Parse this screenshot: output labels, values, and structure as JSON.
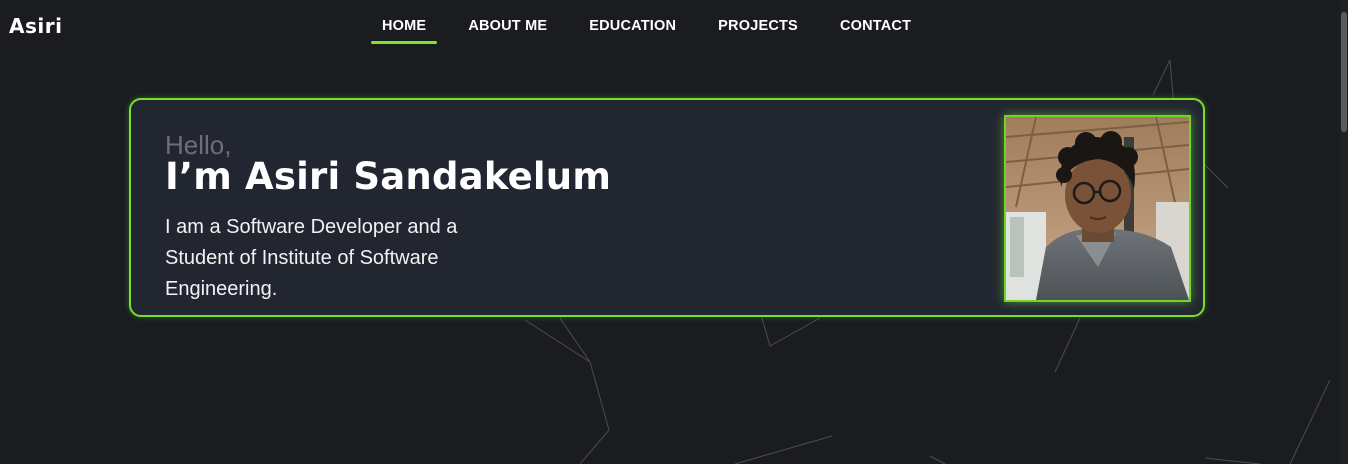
{
  "brand": "Asiri",
  "nav": {
    "items": [
      {
        "label": "HOME",
        "active": true
      },
      {
        "label": "ABOUT ME",
        "active": false
      },
      {
        "label": "EDUCATION",
        "active": false
      },
      {
        "label": "PROJECTS",
        "active": false
      },
      {
        "label": "CONTACT",
        "active": false
      }
    ]
  },
  "hero": {
    "greeting": "Hello,",
    "name": "I’m Asiri Sandakelum",
    "description": "I am a Software Developer and a Student of Institute of Software Engineering."
  },
  "colors": {
    "background": "#1b1c20",
    "card": "#222631",
    "accent": "#76e02b",
    "muted_text": "#6c6f78"
  }
}
